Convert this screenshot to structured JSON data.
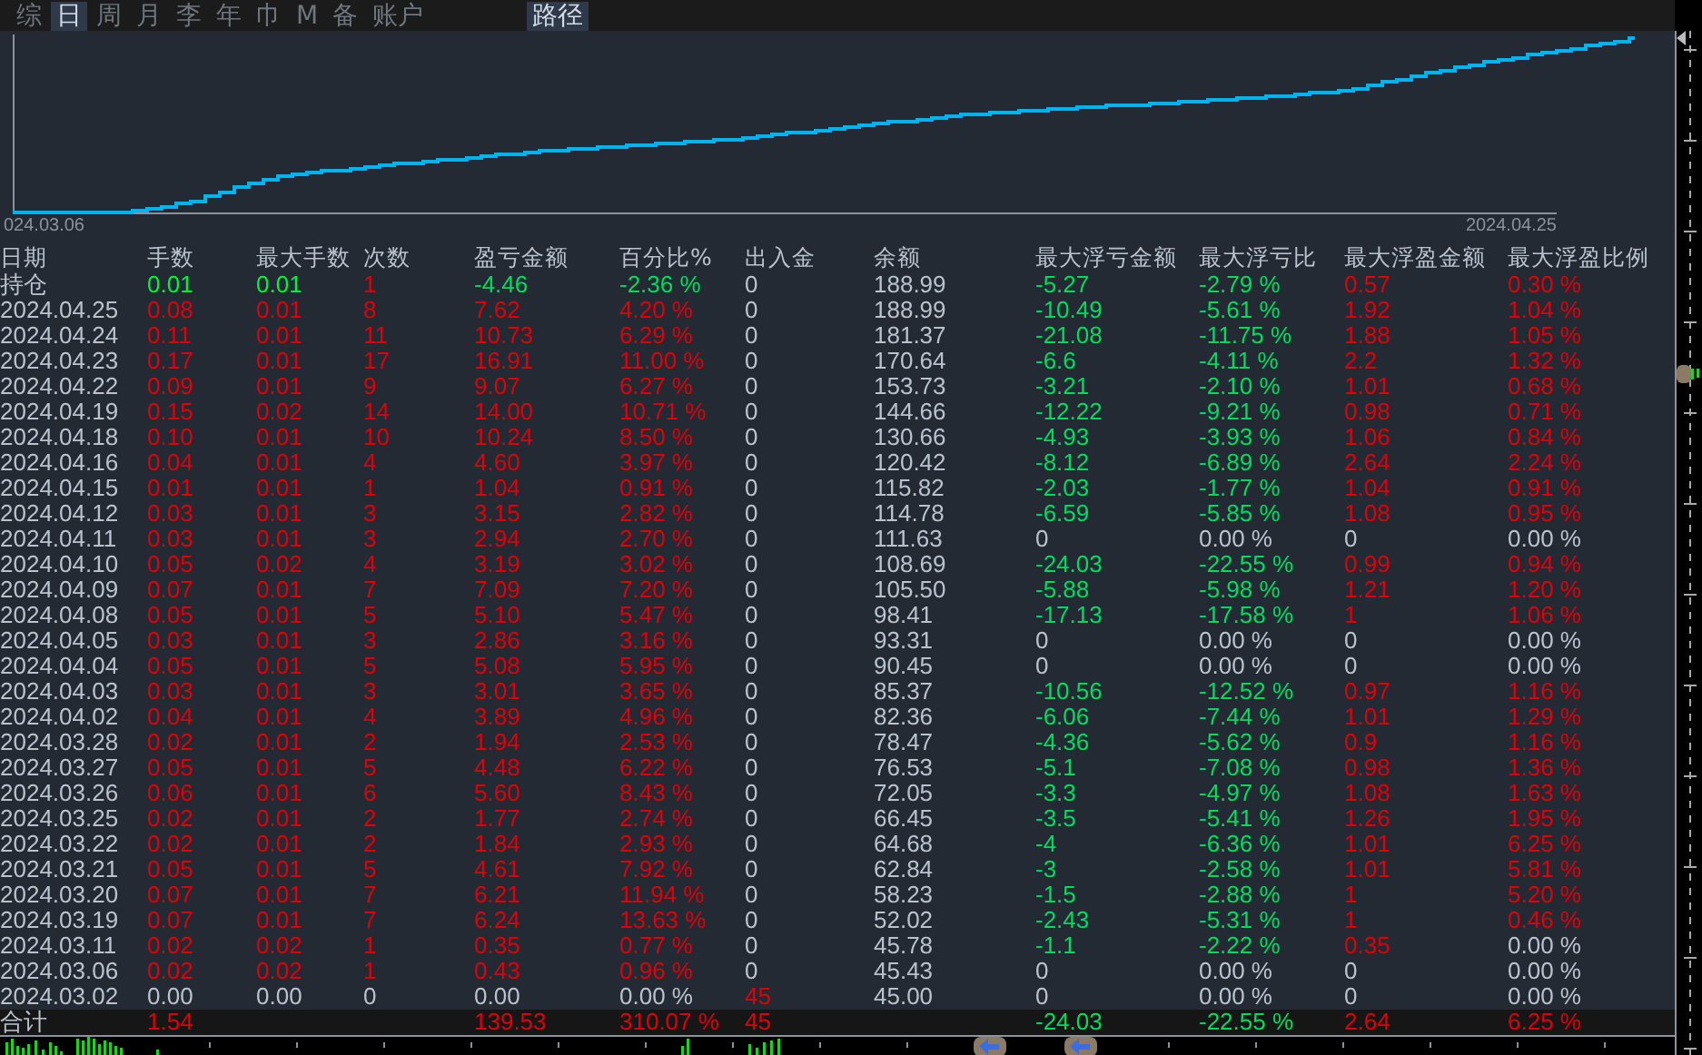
{
  "tabs": [
    {
      "label": "综",
      "selected": false
    },
    {
      "label": "日",
      "selected": true
    },
    {
      "label": "周",
      "selected": false
    },
    {
      "label": "月",
      "selected": false
    },
    {
      "label": "李",
      "selected": false
    },
    {
      "label": "年",
      "selected": false
    },
    {
      "label": "巾",
      "selected": false
    },
    {
      "label": "M",
      "selected": false
    },
    {
      "label": "备",
      "selected": false
    },
    {
      "label": "账户",
      "selected": false
    }
  ],
  "path_button": {
    "label": "路径",
    "selected": true
  },
  "chart": {
    "start_label": "024.03.06",
    "end_label": "2024.04.25"
  },
  "table": {
    "columns": [
      "日期",
      "手数",
      "最大手数",
      "次数",
      "盈亏金额",
      "百分比%",
      "出入金",
      "余额",
      "最大浮亏金额",
      "最大浮亏比",
      "最大浮盈金额",
      "最大浮盈比例"
    ],
    "rows": [
      {
        "kind": "position",
        "cells": [
          {
            "text": "持仓",
            "color": "#b9c2cf"
          },
          {
            "text": "0.01",
            "color": "#00f040"
          },
          {
            "text": "0.01",
            "color": "#00f040"
          },
          {
            "text": "1",
            "color": "#e0000b"
          },
          {
            "text": "-4.46",
            "color": "#00dc60"
          },
          {
            "text": "-2.36 %",
            "color": "#00dc60"
          },
          {
            "text": "0",
            "color": "#b9c2cf"
          },
          {
            "text": "188.99",
            "color": "#b9c2cf"
          },
          {
            "text": "-5.27",
            "color": "#00dc60"
          },
          {
            "text": "-2.79 %",
            "color": "#00dc60"
          },
          {
            "text": "0.57",
            "color": "#e0000b"
          },
          {
            "text": "0.30 %",
            "color": "#e0000b"
          }
        ]
      },
      {
        "kind": "day",
        "cells": [
          {
            "text": "2024.04.25",
            "color": "#b9c2cf"
          },
          {
            "text": "0.08",
            "color": "#e0000b"
          },
          {
            "text": "0.01",
            "color": "#e0000b"
          },
          {
            "text": "8",
            "color": "#e0000b"
          },
          {
            "text": "7.62",
            "color": "#e0000b"
          },
          {
            "text": "4.20 %",
            "color": "#e0000b"
          },
          {
            "text": "0",
            "color": "#b9c2cf"
          },
          {
            "text": "188.99",
            "color": "#b9c2cf"
          },
          {
            "text": "-10.49",
            "color": "#00dc60"
          },
          {
            "text": "-5.61 %",
            "color": "#00dc60"
          },
          {
            "text": "1.92",
            "color": "#e0000b"
          },
          {
            "text": "1.04 %",
            "color": "#e0000b"
          }
        ]
      },
      {
        "kind": "day",
        "cells": [
          {
            "text": "2024.04.24",
            "color": "#b9c2cf"
          },
          {
            "text": "0.11",
            "color": "#e0000b"
          },
          {
            "text": "0.01",
            "color": "#e0000b"
          },
          {
            "text": "11",
            "color": "#e0000b"
          },
          {
            "text": "10.73",
            "color": "#e0000b"
          },
          {
            "text": "6.29 %",
            "color": "#e0000b"
          },
          {
            "text": "0",
            "color": "#b9c2cf"
          },
          {
            "text": "181.37",
            "color": "#b9c2cf"
          },
          {
            "text": "-21.08",
            "color": "#00dc60"
          },
          {
            "text": "-11.75 %",
            "color": "#00dc60"
          },
          {
            "text": "1.88",
            "color": "#e0000b"
          },
          {
            "text": "1.05 %",
            "color": "#e0000b"
          }
        ]
      },
      {
        "kind": "day",
        "cells": [
          {
            "text": "2024.04.23",
            "color": "#b9c2cf"
          },
          {
            "text": "0.17",
            "color": "#e0000b"
          },
          {
            "text": "0.01",
            "color": "#e0000b"
          },
          {
            "text": "17",
            "color": "#e0000b"
          },
          {
            "text": "16.91",
            "color": "#e0000b"
          },
          {
            "text": "11.00 %",
            "color": "#e0000b"
          },
          {
            "text": "0",
            "color": "#b9c2cf"
          },
          {
            "text": "170.64",
            "color": "#b9c2cf"
          },
          {
            "text": "-6.6",
            "color": "#00dc60"
          },
          {
            "text": "-4.11 %",
            "color": "#00dc60"
          },
          {
            "text": "2.2",
            "color": "#e0000b"
          },
          {
            "text": "1.32 %",
            "color": "#e0000b"
          }
        ]
      },
      {
        "kind": "day",
        "cells": [
          {
            "text": "2024.04.22",
            "color": "#b9c2cf"
          },
          {
            "text": "0.09",
            "color": "#e0000b"
          },
          {
            "text": "0.01",
            "color": "#e0000b"
          },
          {
            "text": "9",
            "color": "#e0000b"
          },
          {
            "text": "9.07",
            "color": "#e0000b"
          },
          {
            "text": "6.27 %",
            "color": "#e0000b"
          },
          {
            "text": "0",
            "color": "#b9c2cf"
          },
          {
            "text": "153.73",
            "color": "#b9c2cf"
          },
          {
            "text": "-3.21",
            "color": "#00dc60"
          },
          {
            "text": "-2.10 %",
            "color": "#00dc60"
          },
          {
            "text": "1.01",
            "color": "#e0000b"
          },
          {
            "text": "0.68 %",
            "color": "#e0000b"
          }
        ]
      },
      {
        "kind": "day",
        "cells": [
          {
            "text": "2024.04.19",
            "color": "#b9c2cf"
          },
          {
            "text": "0.15",
            "color": "#e0000b"
          },
          {
            "text": "0.02",
            "color": "#e0000b"
          },
          {
            "text": "14",
            "color": "#e0000b"
          },
          {
            "text": "14.00",
            "color": "#e0000b"
          },
          {
            "text": "10.71 %",
            "color": "#e0000b"
          },
          {
            "text": "0",
            "color": "#b9c2cf"
          },
          {
            "text": "144.66",
            "color": "#b9c2cf"
          },
          {
            "text": "-12.22",
            "color": "#00dc60"
          },
          {
            "text": "-9.21 %",
            "color": "#00dc60"
          },
          {
            "text": "0.98",
            "color": "#e0000b"
          },
          {
            "text": "0.71 %",
            "color": "#e0000b"
          }
        ]
      },
      {
        "kind": "day",
        "cells": [
          {
            "text": "2024.04.18",
            "color": "#b9c2cf"
          },
          {
            "text": "0.10",
            "color": "#e0000b"
          },
          {
            "text": "0.01",
            "color": "#e0000b"
          },
          {
            "text": "10",
            "color": "#e0000b"
          },
          {
            "text": "10.24",
            "color": "#e0000b"
          },
          {
            "text": "8.50 %",
            "color": "#e0000b"
          },
          {
            "text": "0",
            "color": "#b9c2cf"
          },
          {
            "text": "130.66",
            "color": "#b9c2cf"
          },
          {
            "text": "-4.93",
            "color": "#00dc60"
          },
          {
            "text": "-3.93 %",
            "color": "#00dc60"
          },
          {
            "text": "1.06",
            "color": "#e0000b"
          },
          {
            "text": "0.84 %",
            "color": "#e0000b"
          }
        ]
      },
      {
        "kind": "day",
        "cells": [
          {
            "text": "2024.04.16",
            "color": "#b9c2cf"
          },
          {
            "text": "0.04",
            "color": "#e0000b"
          },
          {
            "text": "0.01",
            "color": "#e0000b"
          },
          {
            "text": "4",
            "color": "#e0000b"
          },
          {
            "text": "4.60",
            "color": "#e0000b"
          },
          {
            "text": "3.97 %",
            "color": "#e0000b"
          },
          {
            "text": "0",
            "color": "#b9c2cf"
          },
          {
            "text": "120.42",
            "color": "#b9c2cf"
          },
          {
            "text": "-8.12",
            "color": "#00dc60"
          },
          {
            "text": "-6.89 %",
            "color": "#00dc60"
          },
          {
            "text": "2.64",
            "color": "#e0000b"
          },
          {
            "text": "2.24 %",
            "color": "#e0000b"
          }
        ]
      },
      {
        "kind": "day",
        "cells": [
          {
            "text": "2024.04.15",
            "color": "#b9c2cf"
          },
          {
            "text": "0.01",
            "color": "#e0000b"
          },
          {
            "text": "0.01",
            "color": "#e0000b"
          },
          {
            "text": "1",
            "color": "#e0000b"
          },
          {
            "text": "1.04",
            "color": "#e0000b"
          },
          {
            "text": "0.91 %",
            "color": "#e0000b"
          },
          {
            "text": "0",
            "color": "#b9c2cf"
          },
          {
            "text": "115.82",
            "color": "#b9c2cf"
          },
          {
            "text": "-2.03",
            "color": "#00dc60"
          },
          {
            "text": "-1.77 %",
            "color": "#00dc60"
          },
          {
            "text": "1.04",
            "color": "#e0000b"
          },
          {
            "text": "0.91 %",
            "color": "#e0000b"
          }
        ]
      },
      {
        "kind": "day",
        "cells": [
          {
            "text": "2024.04.12",
            "color": "#b9c2cf"
          },
          {
            "text": "0.03",
            "color": "#e0000b"
          },
          {
            "text": "0.01",
            "color": "#e0000b"
          },
          {
            "text": "3",
            "color": "#e0000b"
          },
          {
            "text": "3.15",
            "color": "#e0000b"
          },
          {
            "text": "2.82 %",
            "color": "#e0000b"
          },
          {
            "text": "0",
            "color": "#b9c2cf"
          },
          {
            "text": "114.78",
            "color": "#b9c2cf"
          },
          {
            "text": "-6.59",
            "color": "#00dc60"
          },
          {
            "text": "-5.85 %",
            "color": "#00dc60"
          },
          {
            "text": "1.08",
            "color": "#e0000b"
          },
          {
            "text": "0.95 %",
            "color": "#e0000b"
          }
        ]
      },
      {
        "kind": "day",
        "cells": [
          {
            "text": "2024.04.11",
            "color": "#b9c2cf"
          },
          {
            "text": "0.03",
            "color": "#e0000b"
          },
          {
            "text": "0.01",
            "color": "#e0000b"
          },
          {
            "text": "3",
            "color": "#e0000b"
          },
          {
            "text": "2.94",
            "color": "#e0000b"
          },
          {
            "text": "2.70 %",
            "color": "#e0000b"
          },
          {
            "text": "0",
            "color": "#b9c2cf"
          },
          {
            "text": "111.63",
            "color": "#b9c2cf"
          },
          {
            "text": "0",
            "color": "#b9c2cf"
          },
          {
            "text": "0.00 %",
            "color": "#b9c2cf"
          },
          {
            "text": "0",
            "color": "#b9c2cf"
          },
          {
            "text": "0.00 %",
            "color": "#b9c2cf"
          }
        ]
      },
      {
        "kind": "day",
        "cells": [
          {
            "text": "2024.04.10",
            "color": "#b9c2cf"
          },
          {
            "text": "0.05",
            "color": "#e0000b"
          },
          {
            "text": "0.02",
            "color": "#e0000b"
          },
          {
            "text": "4",
            "color": "#e0000b"
          },
          {
            "text": "3.19",
            "color": "#e0000b"
          },
          {
            "text": "3.02 %",
            "color": "#e0000b"
          },
          {
            "text": "0",
            "color": "#b9c2cf"
          },
          {
            "text": "108.69",
            "color": "#b9c2cf"
          },
          {
            "text": "-24.03",
            "color": "#00dc60"
          },
          {
            "text": "-22.55 %",
            "color": "#00dc60"
          },
          {
            "text": "0.99",
            "color": "#e0000b"
          },
          {
            "text": "0.94 %",
            "color": "#e0000b"
          }
        ]
      },
      {
        "kind": "day",
        "cells": [
          {
            "text": "2024.04.09",
            "color": "#b9c2cf"
          },
          {
            "text": "0.07",
            "color": "#e0000b"
          },
          {
            "text": "0.01",
            "color": "#e0000b"
          },
          {
            "text": "7",
            "color": "#e0000b"
          },
          {
            "text": "7.09",
            "color": "#e0000b"
          },
          {
            "text": "7.20 %",
            "color": "#e0000b"
          },
          {
            "text": "0",
            "color": "#b9c2cf"
          },
          {
            "text": "105.50",
            "color": "#b9c2cf"
          },
          {
            "text": "-5.88",
            "color": "#00dc60"
          },
          {
            "text": "-5.98 %",
            "color": "#00dc60"
          },
          {
            "text": "1.21",
            "color": "#e0000b"
          },
          {
            "text": "1.20 %",
            "color": "#e0000b"
          }
        ]
      },
      {
        "kind": "day",
        "cells": [
          {
            "text": "2024.04.08",
            "color": "#b9c2cf"
          },
          {
            "text": "0.05",
            "color": "#e0000b"
          },
          {
            "text": "0.01",
            "color": "#e0000b"
          },
          {
            "text": "5",
            "color": "#e0000b"
          },
          {
            "text": "5.10",
            "color": "#e0000b"
          },
          {
            "text": "5.47 %",
            "color": "#e0000b"
          },
          {
            "text": "0",
            "color": "#b9c2cf"
          },
          {
            "text": "98.41",
            "color": "#b9c2cf"
          },
          {
            "text": "-17.13",
            "color": "#00dc60"
          },
          {
            "text": "-17.58 %",
            "color": "#00dc60"
          },
          {
            "text": "1",
            "color": "#e0000b"
          },
          {
            "text": "1.06 %",
            "color": "#e0000b"
          }
        ]
      },
      {
        "kind": "day",
        "cells": [
          {
            "text": "2024.04.05",
            "color": "#b9c2cf"
          },
          {
            "text": "0.03",
            "color": "#e0000b"
          },
          {
            "text": "0.01",
            "color": "#e0000b"
          },
          {
            "text": "3",
            "color": "#e0000b"
          },
          {
            "text": "2.86",
            "color": "#e0000b"
          },
          {
            "text": "3.16 %",
            "color": "#e0000b"
          },
          {
            "text": "0",
            "color": "#b9c2cf"
          },
          {
            "text": "93.31",
            "color": "#b9c2cf"
          },
          {
            "text": "0",
            "color": "#b9c2cf"
          },
          {
            "text": "0.00 %",
            "color": "#b9c2cf"
          },
          {
            "text": "0",
            "color": "#b9c2cf"
          },
          {
            "text": "0.00 %",
            "color": "#b9c2cf"
          }
        ]
      },
      {
        "kind": "day",
        "cells": [
          {
            "text": "2024.04.04",
            "color": "#b9c2cf"
          },
          {
            "text": "0.05",
            "color": "#e0000b"
          },
          {
            "text": "0.01",
            "color": "#e0000b"
          },
          {
            "text": "5",
            "color": "#e0000b"
          },
          {
            "text": "5.08",
            "color": "#e0000b"
          },
          {
            "text": "5.95 %",
            "color": "#e0000b"
          },
          {
            "text": "0",
            "color": "#b9c2cf"
          },
          {
            "text": "90.45",
            "color": "#b9c2cf"
          },
          {
            "text": "0",
            "color": "#b9c2cf"
          },
          {
            "text": "0.00 %",
            "color": "#b9c2cf"
          },
          {
            "text": "0",
            "color": "#b9c2cf"
          },
          {
            "text": "0.00 %",
            "color": "#b9c2cf"
          }
        ]
      },
      {
        "kind": "day",
        "cells": [
          {
            "text": "2024.04.03",
            "color": "#b9c2cf"
          },
          {
            "text": "0.03",
            "color": "#e0000b"
          },
          {
            "text": "0.01",
            "color": "#e0000b"
          },
          {
            "text": "3",
            "color": "#e0000b"
          },
          {
            "text": "3.01",
            "color": "#e0000b"
          },
          {
            "text": "3.65 %",
            "color": "#e0000b"
          },
          {
            "text": "0",
            "color": "#b9c2cf"
          },
          {
            "text": "85.37",
            "color": "#b9c2cf"
          },
          {
            "text": "-10.56",
            "color": "#00dc60"
          },
          {
            "text": "-12.52 %",
            "color": "#00dc60"
          },
          {
            "text": "0.97",
            "color": "#e0000b"
          },
          {
            "text": "1.16 %",
            "color": "#e0000b"
          }
        ]
      },
      {
        "kind": "day",
        "cells": [
          {
            "text": "2024.04.02",
            "color": "#b9c2cf"
          },
          {
            "text": "0.04",
            "color": "#e0000b"
          },
          {
            "text": "0.01",
            "color": "#e0000b"
          },
          {
            "text": "4",
            "color": "#e0000b"
          },
          {
            "text": "3.89",
            "color": "#e0000b"
          },
          {
            "text": "4.96 %",
            "color": "#e0000b"
          },
          {
            "text": "0",
            "color": "#b9c2cf"
          },
          {
            "text": "82.36",
            "color": "#b9c2cf"
          },
          {
            "text": "-6.06",
            "color": "#00dc60"
          },
          {
            "text": "-7.44 %",
            "color": "#00dc60"
          },
          {
            "text": "1.01",
            "color": "#e0000b"
          },
          {
            "text": "1.29 %",
            "color": "#e0000b"
          }
        ]
      },
      {
        "kind": "day",
        "cells": [
          {
            "text": "2024.03.28",
            "color": "#b9c2cf"
          },
          {
            "text": "0.02",
            "color": "#e0000b"
          },
          {
            "text": "0.01",
            "color": "#e0000b"
          },
          {
            "text": "2",
            "color": "#e0000b"
          },
          {
            "text": "1.94",
            "color": "#e0000b"
          },
          {
            "text": "2.53 %",
            "color": "#e0000b"
          },
          {
            "text": "0",
            "color": "#b9c2cf"
          },
          {
            "text": "78.47",
            "color": "#b9c2cf"
          },
          {
            "text": "-4.36",
            "color": "#00dc60"
          },
          {
            "text": "-5.62 %",
            "color": "#00dc60"
          },
          {
            "text": "0.9",
            "color": "#e0000b"
          },
          {
            "text": "1.16 %",
            "color": "#e0000b"
          }
        ]
      },
      {
        "kind": "day",
        "cells": [
          {
            "text": "2024.03.27",
            "color": "#b9c2cf"
          },
          {
            "text": "0.05",
            "color": "#e0000b"
          },
          {
            "text": "0.01",
            "color": "#e0000b"
          },
          {
            "text": "5",
            "color": "#e0000b"
          },
          {
            "text": "4.48",
            "color": "#e0000b"
          },
          {
            "text": "6.22 %",
            "color": "#e0000b"
          },
          {
            "text": "0",
            "color": "#b9c2cf"
          },
          {
            "text": "76.53",
            "color": "#b9c2cf"
          },
          {
            "text": "-5.1",
            "color": "#00dc60"
          },
          {
            "text": "-7.08 %",
            "color": "#00dc60"
          },
          {
            "text": "0.98",
            "color": "#e0000b"
          },
          {
            "text": "1.36 %",
            "color": "#e0000b"
          }
        ]
      },
      {
        "kind": "day",
        "cells": [
          {
            "text": "2024.03.26",
            "color": "#b9c2cf"
          },
          {
            "text": "0.06",
            "color": "#e0000b"
          },
          {
            "text": "0.01",
            "color": "#e0000b"
          },
          {
            "text": "6",
            "color": "#e0000b"
          },
          {
            "text": "5.60",
            "color": "#e0000b"
          },
          {
            "text": "8.43 %",
            "color": "#e0000b"
          },
          {
            "text": "0",
            "color": "#b9c2cf"
          },
          {
            "text": "72.05",
            "color": "#b9c2cf"
          },
          {
            "text": "-3.3",
            "color": "#00dc60"
          },
          {
            "text": "-4.97 %",
            "color": "#00dc60"
          },
          {
            "text": "1.08",
            "color": "#e0000b"
          },
          {
            "text": "1.63 %",
            "color": "#e0000b"
          }
        ]
      },
      {
        "kind": "day",
        "cells": [
          {
            "text": "2024.03.25",
            "color": "#b9c2cf"
          },
          {
            "text": "0.02",
            "color": "#e0000b"
          },
          {
            "text": "0.01",
            "color": "#e0000b"
          },
          {
            "text": "2",
            "color": "#e0000b"
          },
          {
            "text": "1.77",
            "color": "#e0000b"
          },
          {
            "text": "2.74 %",
            "color": "#e0000b"
          },
          {
            "text": "0",
            "color": "#b9c2cf"
          },
          {
            "text": "66.45",
            "color": "#b9c2cf"
          },
          {
            "text": "-3.5",
            "color": "#00dc60"
          },
          {
            "text": "-5.41 %",
            "color": "#00dc60"
          },
          {
            "text": "1.26",
            "color": "#e0000b"
          },
          {
            "text": "1.95 %",
            "color": "#e0000b"
          }
        ]
      },
      {
        "kind": "day",
        "cells": [
          {
            "text": "2024.03.22",
            "color": "#b9c2cf"
          },
          {
            "text": "0.02",
            "color": "#e0000b"
          },
          {
            "text": "0.01",
            "color": "#e0000b"
          },
          {
            "text": "2",
            "color": "#e0000b"
          },
          {
            "text": "1.84",
            "color": "#e0000b"
          },
          {
            "text": "2.93 %",
            "color": "#e0000b"
          },
          {
            "text": "0",
            "color": "#b9c2cf"
          },
          {
            "text": "64.68",
            "color": "#b9c2cf"
          },
          {
            "text": "-4",
            "color": "#00dc60"
          },
          {
            "text": "-6.36 %",
            "color": "#00dc60"
          },
          {
            "text": "1.01",
            "color": "#e0000b"
          },
          {
            "text": "6.25 %",
            "color": "#e0000b"
          }
        ]
      },
      {
        "kind": "day",
        "cells": [
          {
            "text": "2024.03.21",
            "color": "#b9c2cf"
          },
          {
            "text": "0.05",
            "color": "#e0000b"
          },
          {
            "text": "0.01",
            "color": "#e0000b"
          },
          {
            "text": "5",
            "color": "#e0000b"
          },
          {
            "text": "4.61",
            "color": "#e0000b"
          },
          {
            "text": "7.92 %",
            "color": "#e0000b"
          },
          {
            "text": "0",
            "color": "#b9c2cf"
          },
          {
            "text": "62.84",
            "color": "#b9c2cf"
          },
          {
            "text": "-3",
            "color": "#00dc60"
          },
          {
            "text": "-2.58 %",
            "color": "#00dc60"
          },
          {
            "text": "1.01",
            "color": "#e0000b"
          },
          {
            "text": "5.81 %",
            "color": "#e0000b"
          }
        ]
      },
      {
        "kind": "day",
        "cells": [
          {
            "text": "2024.03.20",
            "color": "#b9c2cf"
          },
          {
            "text": "0.07",
            "color": "#e0000b"
          },
          {
            "text": "0.01",
            "color": "#e0000b"
          },
          {
            "text": "7",
            "color": "#e0000b"
          },
          {
            "text": "6.21",
            "color": "#e0000b"
          },
          {
            "text": "11.94 %",
            "color": "#e0000b"
          },
          {
            "text": "0",
            "color": "#b9c2cf"
          },
          {
            "text": "58.23",
            "color": "#b9c2cf"
          },
          {
            "text": "-1.5",
            "color": "#00dc60"
          },
          {
            "text": "-2.88 %",
            "color": "#00dc60"
          },
          {
            "text": "1",
            "color": "#e0000b"
          },
          {
            "text": "5.20 %",
            "color": "#e0000b"
          }
        ]
      },
      {
        "kind": "day",
        "cells": [
          {
            "text": "2024.03.19",
            "color": "#b9c2cf"
          },
          {
            "text": "0.07",
            "color": "#e0000b"
          },
          {
            "text": "0.01",
            "color": "#e0000b"
          },
          {
            "text": "7",
            "color": "#e0000b"
          },
          {
            "text": "6.24",
            "color": "#e0000b"
          },
          {
            "text": "13.63 %",
            "color": "#e0000b"
          },
          {
            "text": "0",
            "color": "#b9c2cf"
          },
          {
            "text": "52.02",
            "color": "#b9c2cf"
          },
          {
            "text": "-2.43",
            "color": "#00dc60"
          },
          {
            "text": "-5.31 %",
            "color": "#00dc60"
          },
          {
            "text": "1",
            "color": "#e0000b"
          },
          {
            "text": "0.46 %",
            "color": "#e0000b"
          }
        ]
      },
      {
        "kind": "day",
        "cells": [
          {
            "text": "2024.03.11",
            "color": "#b9c2cf"
          },
          {
            "text": "0.02",
            "color": "#e0000b"
          },
          {
            "text": "0.02",
            "color": "#e0000b"
          },
          {
            "text": "1",
            "color": "#e0000b"
          },
          {
            "text": "0.35",
            "color": "#e0000b"
          },
          {
            "text": "0.77 %",
            "color": "#e0000b"
          },
          {
            "text": "0",
            "color": "#b9c2cf"
          },
          {
            "text": "45.78",
            "color": "#b9c2cf"
          },
          {
            "text": "-1.1",
            "color": "#00dc60"
          },
          {
            "text": "-2.22 %",
            "color": "#00dc60"
          },
          {
            "text": "0.35",
            "color": "#e0000b"
          },
          {
            "text": "0.00 %",
            "color": "#b9c2cf"
          }
        ]
      },
      {
        "kind": "day",
        "cells": [
          {
            "text": "2024.03.06",
            "color": "#b9c2cf"
          },
          {
            "text": "0.02",
            "color": "#e0000b"
          },
          {
            "text": "0.02",
            "color": "#e0000b"
          },
          {
            "text": "1",
            "color": "#e0000b"
          },
          {
            "text": "0.43",
            "color": "#e0000b"
          },
          {
            "text": "0.96 %",
            "color": "#e0000b"
          },
          {
            "text": "0",
            "color": "#b9c2cf"
          },
          {
            "text": "45.43",
            "color": "#b9c2cf"
          },
          {
            "text": "0",
            "color": "#b9c2cf"
          },
          {
            "text": "0.00 %",
            "color": "#b9c2cf"
          },
          {
            "text": "0",
            "color": "#b9c2cf"
          },
          {
            "text": "0.00 %",
            "color": "#b9c2cf"
          }
        ]
      },
      {
        "kind": "day",
        "cells": [
          {
            "text": "2024.03.02",
            "color": "#b9c2cf"
          },
          {
            "text": "0.00",
            "color": "#b9c2cf"
          },
          {
            "text": "0.00",
            "color": "#b9c2cf"
          },
          {
            "text": "0",
            "color": "#b9c2cf"
          },
          {
            "text": "0.00",
            "color": "#b9c2cf"
          },
          {
            "text": "0.00 %",
            "color": "#b9c2cf"
          },
          {
            "text": "45",
            "color": "#e0000b"
          },
          {
            "text": "45.00",
            "color": "#b9c2cf"
          },
          {
            "text": "0",
            "color": "#b9c2cf"
          },
          {
            "text": "0.00 %",
            "color": "#b9c2cf"
          },
          {
            "text": "0",
            "color": "#b9c2cf"
          },
          {
            "text": "0.00 %",
            "color": "#b9c2cf"
          }
        ]
      },
      {
        "kind": "total",
        "cells": [
          {
            "text": "合计",
            "color": "#b9c2cf"
          },
          {
            "text": "1.54",
            "color": "#e0000b"
          },
          {
            "text": ""
          },
          {
            "text": ""
          },
          {
            "text": "139.53",
            "color": "#e0000b"
          },
          {
            "text": "310.07 %",
            "color": "#e0000b"
          },
          {
            "text": "45",
            "color": "#e0000b"
          },
          {
            "text": ""
          },
          {
            "text": "-24.03",
            "color": "#00dc60"
          },
          {
            "text": "-22.55 %",
            "color": "#00dc60"
          },
          {
            "text": "2.64",
            "color": "#e0000b"
          },
          {
            "text": "6.25 %",
            "color": "#e0000b"
          }
        ]
      }
    ]
  }
}
